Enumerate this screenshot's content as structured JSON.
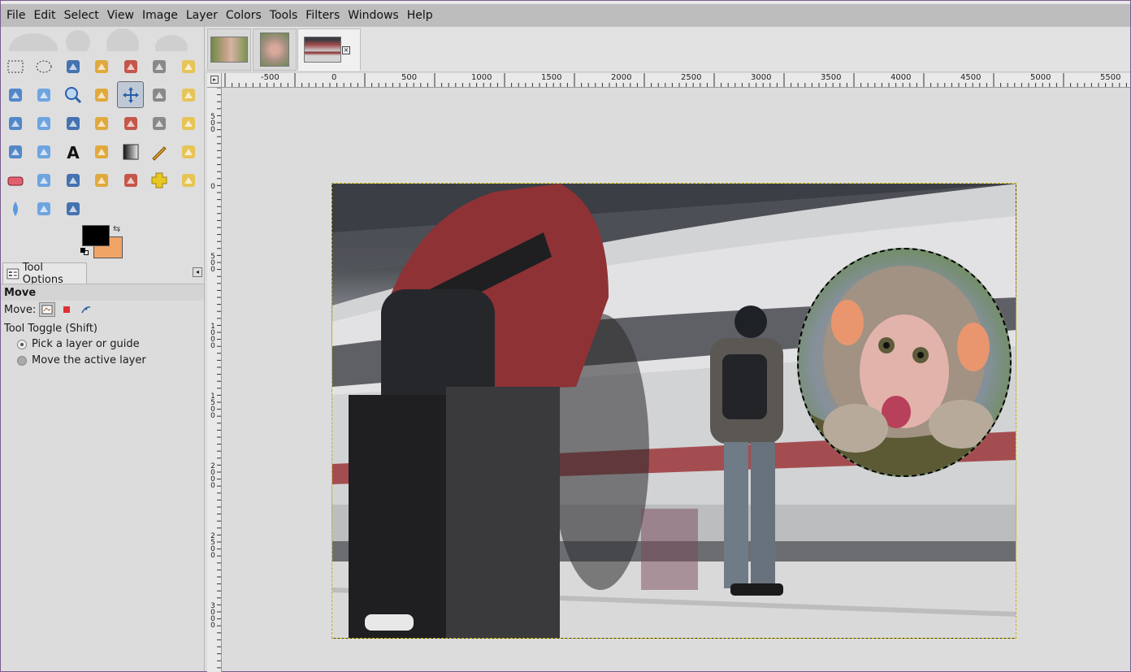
{
  "menubar": {
    "items": [
      "File",
      "Edit",
      "Select",
      "View",
      "Image",
      "Layer",
      "Colors",
      "Tools",
      "Filters",
      "Windows",
      "Help"
    ]
  },
  "toolbox": {
    "tools": [
      "rect-select-icon",
      "ellipse-select-icon",
      "free-select-icon",
      "fuzzy-select-icon",
      "select-by-color-icon",
      "scissors-select-icon",
      "foreground-select-icon",
      "paths-icon",
      "color-picker-icon",
      "zoom-icon",
      "measure-icon",
      "move-icon",
      "align-icon",
      "crop-icon",
      "rotate-icon",
      "scale-icon",
      "shear-icon",
      "perspective-icon",
      "transform-3d-icon",
      "unified-transform-icon",
      "flip-icon",
      "cage-transform-icon",
      "warp-transform-icon",
      "text-icon",
      "bucket-fill-icon",
      "gradient-icon",
      "pencil-icon",
      "paintbrush-icon",
      "eraser-icon",
      "airbrush-icon",
      "ink-icon",
      "mypaint-brush-icon",
      "clone-icon",
      "heal-icon",
      "perspective-clone-icon",
      "blur-sharpen-icon",
      "smudge-icon",
      "dodge-burn-icon"
    ],
    "active_tool": "move-icon",
    "colors": {
      "foreground": "#000000",
      "background": "#f0a466"
    }
  },
  "tool_options": {
    "tab_label": "Tool Options",
    "title": "Move",
    "move_label": "Move:",
    "toggle_label": "Tool Toggle  (Shift)",
    "option_pick": "Pick a layer or guide",
    "option_active": "Move the active layer"
  },
  "image_tabs": [
    "monkey-thumbnail",
    "monkey-portrait-thumbnail",
    "train-station-thumbnail"
  ],
  "ruler": {
    "top_labels": [
      "-500",
      "0",
      "500",
      "1000",
      "1500",
      "2000",
      "2500",
      "3000",
      "3500",
      "4000",
      "4500",
      "5000",
      "5500"
    ],
    "left_labels": [
      "500",
      "0",
      "500",
      "1000",
      "1500",
      "2000",
      "2500",
      "3000"
    ]
  }
}
